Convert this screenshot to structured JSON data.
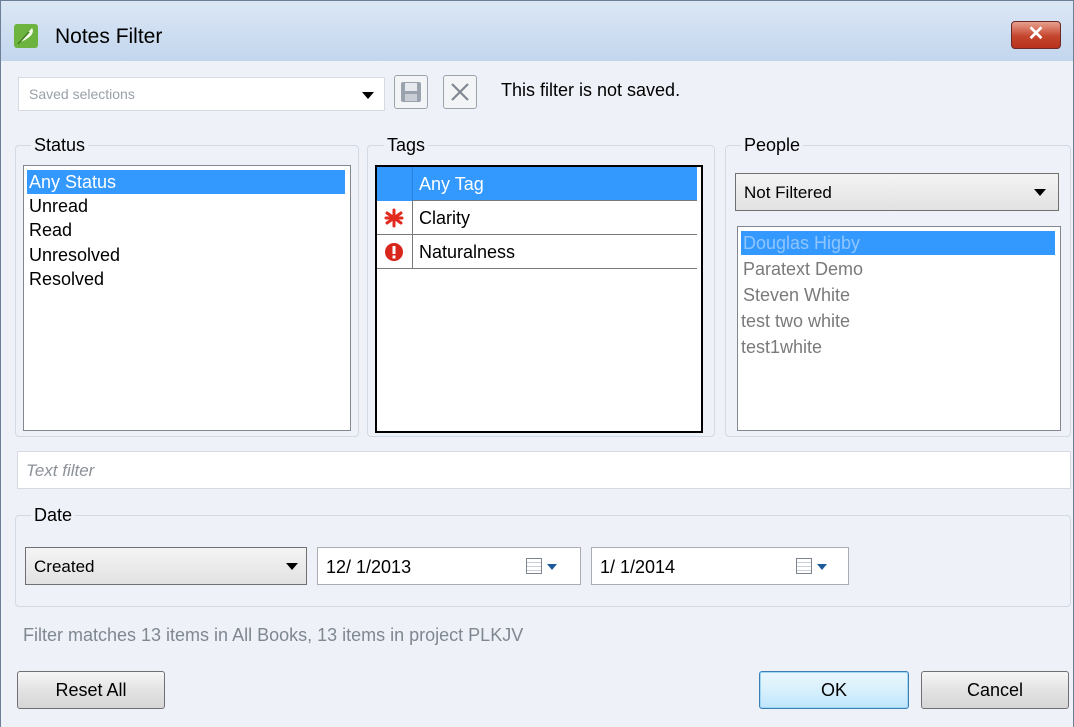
{
  "window": {
    "title": "Notes Filter",
    "close_label": "✕"
  },
  "saved": {
    "placeholder": "Saved selections",
    "status_message": "This filter is not saved."
  },
  "status": {
    "label": "Status",
    "items": [
      "Any Status",
      "Unread",
      "Read",
      "Unresolved",
      "Resolved"
    ],
    "selected": "Any Status"
  },
  "tags": {
    "label": "Tags",
    "items": [
      {
        "label": "Any Tag",
        "icon": "none"
      },
      {
        "label": "Clarity",
        "icon": "red-asterisk-icon"
      },
      {
        "label": "Naturalness",
        "icon": "red-exclamation-icon"
      }
    ],
    "selected": "Any Tag"
  },
  "people": {
    "label": "People",
    "filter_value": "Not Filtered",
    "items": [
      "Douglas Higby",
      "Paratext Demo",
      "Steven White",
      "test two white",
      "test1white"
    ],
    "selected": "Douglas Higby"
  },
  "text_filter": {
    "placeholder": "Text filter"
  },
  "date": {
    "label": "Date",
    "type_value": "Created",
    "from": "12/ 1/2013",
    "to": "1/ 1/2014"
  },
  "summary": "Filter matches 13 items in All Books, 13 items in project PLKJV",
  "buttons": {
    "reset": "Reset All",
    "ok": "OK",
    "cancel": "Cancel"
  },
  "colors": {
    "selection": "#3399ff",
    "window_bg": "#eef2f8",
    "close_red": "#c4452d"
  }
}
